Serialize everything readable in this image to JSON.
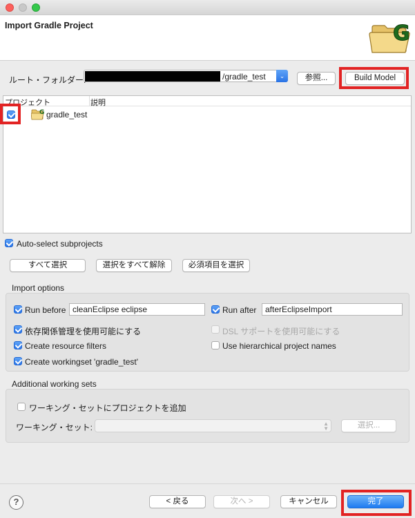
{
  "window": {
    "title": "Import Gradle Project"
  },
  "root_folder": {
    "label": "ルート・フォルダー:",
    "path": "/gradle_test",
    "browse_label": "参照...",
    "build_model_label": "Build Model"
  },
  "tree": {
    "columns": [
      "プロジェクト",
      "説明"
    ],
    "rows": [
      {
        "name": "gradle_test",
        "checked": true
      }
    ]
  },
  "auto_select": {
    "label": "Auto-select subprojects",
    "checked": true
  },
  "selection_buttons": {
    "select_all": "すべて選択",
    "deselect_all": "選択をすべて解除",
    "select_required": "必須項目を選択"
  },
  "import_options": {
    "title": "Import options",
    "run_before": {
      "label": "Run before",
      "value": "cleanEclipse eclipse",
      "checked": true
    },
    "run_after": {
      "label": "Run after",
      "value": "afterEclipseImport",
      "checked": true
    },
    "dependency_mgmt": {
      "label": "依存関係管理を使用可能にする",
      "checked": true
    },
    "dsl_support": {
      "label": "DSL サポートを使用可能にする",
      "checked": false,
      "disabled": true
    },
    "resource_filters": {
      "label": "Create resource filters",
      "checked": true
    },
    "hierarchical_names": {
      "label": "Use hierarchical project names",
      "checked": false
    },
    "workingset": {
      "label": "Create workingset 'gradle_test'",
      "checked": true
    }
  },
  "working_sets": {
    "title": "Additional working sets",
    "add_label": "ワーキング・セットにプロジェクトを追加",
    "add_checked": false,
    "set_label": "ワーキング・セット:",
    "select_label": "選択..."
  },
  "footer": {
    "help_icon": "?",
    "back_label": "< 戻る",
    "next_label": "次へ >",
    "cancel_label": "キャンセル",
    "finish_label": "完了"
  },
  "colors": {
    "accent": "#2b75e8",
    "highlight": "#e22323"
  }
}
